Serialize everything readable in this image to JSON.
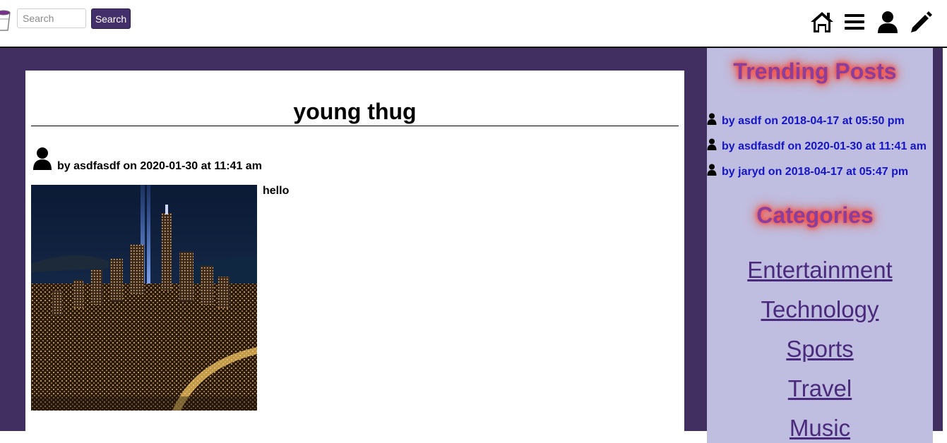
{
  "header": {
    "search_placeholder": "Search",
    "search_button": "Search",
    "icons": [
      "home-icon",
      "menu-icon",
      "user-icon",
      "pencil-icon"
    ]
  },
  "post": {
    "title": "young thug",
    "author_line": "by asdfasdf on 2020-01-30 at 11:41 am",
    "body": "hello"
  },
  "sidebar": {
    "trending_heading": "Trending Posts",
    "trending": [
      {
        "label": "by asdf on 2018-04-17 at 05:50 pm"
      },
      {
        "label": "by asdfasdf on 2020-01-30 at 11:41 am"
      },
      {
        "label": "by jaryd on 2018-04-17 at 05:47 pm"
      }
    ],
    "categories_heading": "Categories",
    "categories": [
      "Entertainment",
      "Technology",
      "Sports",
      "Travel",
      "Music"
    ]
  },
  "colors": {
    "brand_purple": "#412f61",
    "sidebar_bg": "#bfbde0",
    "heading_glow": "#ff3b2f",
    "trending_link": "#1515c8",
    "category_link": "#4a2a7c"
  }
}
